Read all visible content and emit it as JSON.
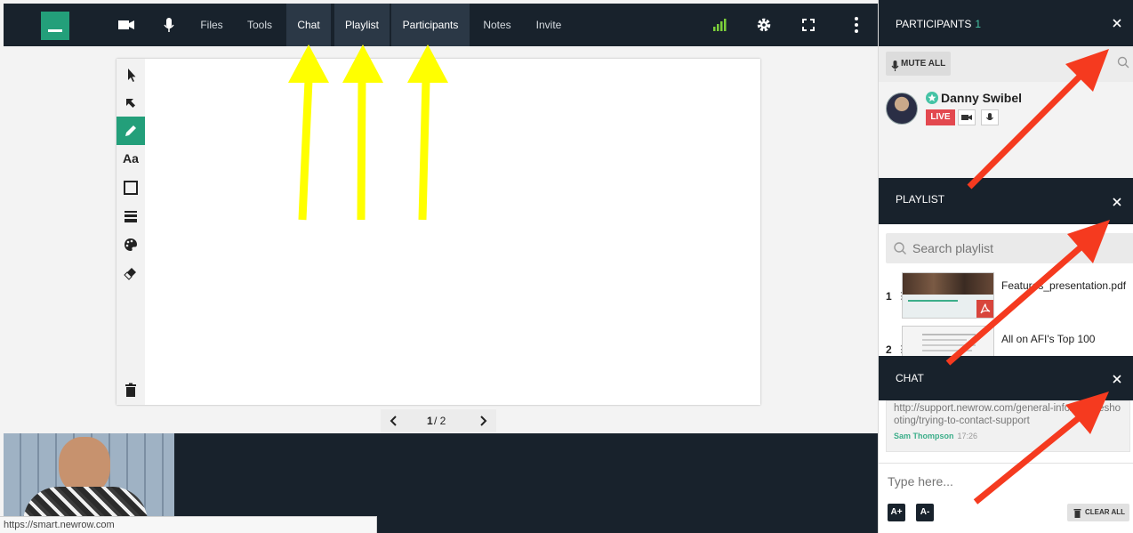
{
  "topbar": {
    "menu": [
      {
        "label": "Files",
        "active": false
      },
      {
        "label": "Tools",
        "active": false
      },
      {
        "label": "Chat",
        "active": true
      },
      {
        "label": "Playlist",
        "active": true
      },
      {
        "label": "Participants",
        "active": true
      },
      {
        "label": "Notes",
        "active": false
      },
      {
        "label": "Invite",
        "active": false
      }
    ],
    "icons": [
      "camera-icon",
      "mic-icon",
      "signal-icon",
      "gear-icon",
      "fullscreen-icon",
      "more-icon"
    ]
  },
  "participants": {
    "title": "PARTICIPANTS",
    "count": "1",
    "mute_all": "MUTE ALL",
    "list": [
      {
        "name": "Danny Swibel",
        "live_label": "LIVE"
      }
    ]
  },
  "playlist": {
    "title": "PLAYLIST",
    "search_placeholder": "Search playlist",
    "items": [
      {
        "number": "1",
        "name": "Features_presentation.pdf"
      },
      {
        "number": "2",
        "name": "All on AFI's Top 100"
      }
    ]
  },
  "chat": {
    "title": "CHAT",
    "messages": [
      {
        "text": "http://support.newrow.com/general-info/troubleshooting/trying-to-contact-support",
        "author": "Sam Thompson",
        "time": "17:26"
      }
    ],
    "input_placeholder": "Type here...",
    "font_increase": "A+",
    "font_decrease": "A-",
    "clear_all": "CLEAR ALL"
  },
  "whiteboard": {
    "page_current": "1",
    "page_total": "/ 2",
    "tools": [
      "pointer-icon",
      "select-icon",
      "pencil-icon",
      "text-icon",
      "rectangle-icon",
      "line-width-icon",
      "palette-icon",
      "eraser-icon",
      "trash-icon"
    ],
    "text_tool_label": "Aa"
  },
  "statusbar": {
    "url": "https://smart.newrow.com"
  },
  "colors": {
    "topbar": "#18222c",
    "accent": "#239f7a",
    "live": "#e3484f",
    "annotation_yellow": "#ffff00",
    "annotation_red": "#f53a1f"
  }
}
